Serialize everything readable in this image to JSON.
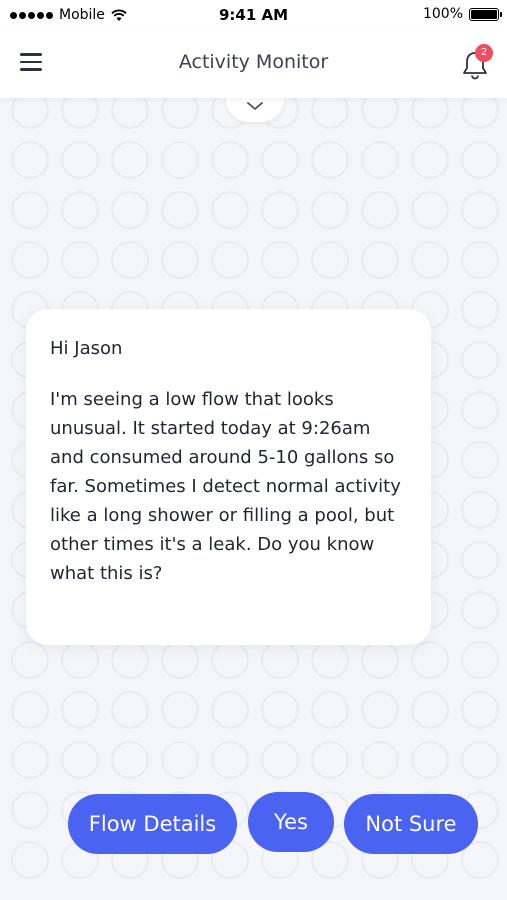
{
  "status_bar": {
    "carrier": "Mobile",
    "time": "9:41 AM",
    "battery": "100%"
  },
  "header": {
    "title": "Activity Monitor",
    "notification_count": "2",
    "menu_icon": "hamburger-menu-icon",
    "bell_icon": "bell-icon"
  },
  "message": {
    "greeting": "Hi Jason",
    "body": "I'm seeing a low flow that looks unusual. It started today at 9:26am and consumed around 5-10 gallons so far. Sometimes I detect normal activity like a long shower or filling a pool, but other times it's a leak. Do you know what this is?"
  },
  "replies": {
    "flow_details": "Flow Details",
    "yes": "Yes",
    "not_sure": "Not Sure"
  },
  "colors": {
    "accent": "#4a63f0",
    "badge": "#ef4e5f",
    "background": "#f5f6fa"
  }
}
